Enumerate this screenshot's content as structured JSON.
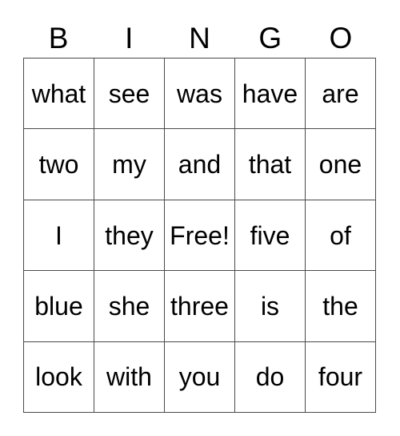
{
  "card": {
    "title": "BINGO",
    "free_space_label": "Free!",
    "header": {
      "letters": [
        "B",
        "I",
        "N",
        "G",
        "O"
      ]
    },
    "grid": {
      "columns": 5,
      "rows": 5,
      "border_color": "#4a4a4a",
      "background_color": "#ffffff",
      "text_color": "#000000",
      "cells": [
        [
          {
            "text": "what",
            "free": false
          },
          {
            "text": "see",
            "free": false
          },
          {
            "text": "was",
            "free": false
          },
          {
            "text": "have",
            "free": false
          },
          {
            "text": "are",
            "free": false
          }
        ],
        [
          {
            "text": "two",
            "free": false
          },
          {
            "text": "my",
            "free": false
          },
          {
            "text": "and",
            "free": false
          },
          {
            "text": "that",
            "free": false
          },
          {
            "text": "one",
            "free": false
          }
        ],
        [
          {
            "text": "I",
            "free": false
          },
          {
            "text": "they",
            "free": false
          },
          {
            "text": "Free!",
            "free": true
          },
          {
            "text": "five",
            "free": false
          },
          {
            "text": "of",
            "free": false
          }
        ],
        [
          {
            "text": "blue",
            "free": false
          },
          {
            "text": "she",
            "free": false
          },
          {
            "text": "three",
            "free": false
          },
          {
            "text": "is",
            "free": false
          },
          {
            "text": "the",
            "free": false
          }
        ],
        [
          {
            "text": "look",
            "free": false
          },
          {
            "text": "with",
            "free": false
          },
          {
            "text": "you",
            "free": false
          },
          {
            "text": "do",
            "free": false
          },
          {
            "text": "four",
            "free": false
          }
        ]
      ]
    }
  }
}
